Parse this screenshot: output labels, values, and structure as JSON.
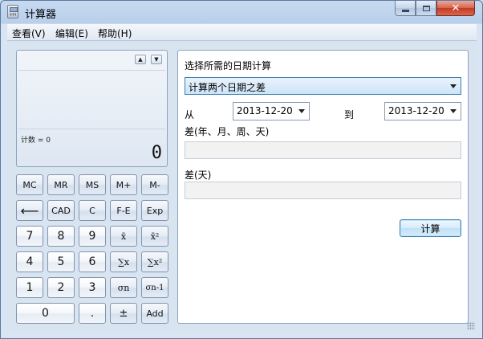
{
  "window": {
    "title": "计算器",
    "minimize_glyph": "",
    "close_glyph": "✕"
  },
  "menu": [
    {
      "label": "查看(V)"
    },
    {
      "label": "编辑(E)"
    },
    {
      "label": "帮助(H)"
    }
  ],
  "display": {
    "scroll_up": "▲",
    "scroll_down": "▼",
    "memory_text": "计数 = 0",
    "value": "0"
  },
  "keypad": {
    "memory": [
      "MC",
      "MR",
      "MS",
      "M+",
      "M-"
    ],
    "row2": [
      "⟵",
      "CAD",
      "C",
      "F-E",
      "Exp"
    ],
    "row3": [
      "7",
      "8",
      "9",
      "x̄",
      "x̄²"
    ],
    "row4": [
      "4",
      "5",
      "6",
      "∑x",
      "∑x²"
    ],
    "row5": [
      "1",
      "2",
      "3",
      "σn",
      "σn-1"
    ],
    "zero": "0",
    "dot": ".",
    "plusminus": "±",
    "add": "Add"
  },
  "date_panel": {
    "select_label": "选择所需的日期计算",
    "mode": "计算两个日期之差",
    "from_label": "从",
    "from_date": "2013-12-20",
    "to_label": "到",
    "to_date": "2013-12-20",
    "diff_ymwd_label": "差(年、月、周、天)",
    "diff_ymwd_value": "",
    "diff_days_label": "差(天)",
    "diff_days_value": "",
    "calculate_label": "计算"
  }
}
